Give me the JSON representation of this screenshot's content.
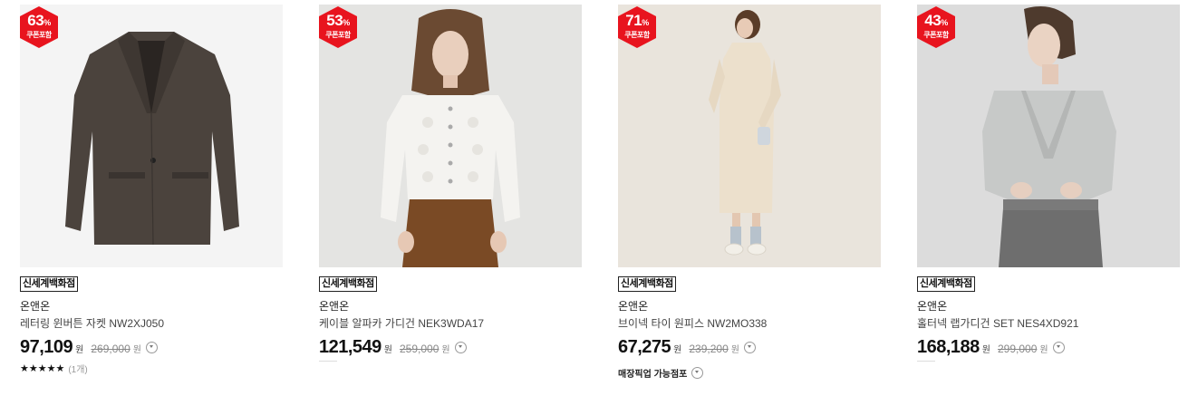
{
  "colors": {
    "badge_red": "#e8141e",
    "text": "#222222",
    "muted": "#888888"
  },
  "products": [
    {
      "discount": "63",
      "percent_sign": "%",
      "coupon_label": "쿠폰포함",
      "store": "신세계백화점",
      "brand": "온앤온",
      "name": "레터링 윈버튼 자켓 NW2XJ050",
      "price": "97,109",
      "price_unit": "원",
      "original_price": "269,000",
      "original_unit": "원",
      "stars": "★★★★★",
      "rating_count": "(1개)"
    },
    {
      "discount": "53",
      "percent_sign": "%",
      "coupon_label": "쿠폰포함",
      "store": "신세계백화점",
      "brand": "온앤온",
      "name": "케이블 알파카 가디건 NEK3WDA17",
      "price": "121,549",
      "price_unit": "원",
      "original_price": "259,000",
      "original_unit": "원"
    },
    {
      "discount": "71",
      "percent_sign": "%",
      "coupon_label": "쿠폰포함",
      "store": "신세계백화점",
      "brand": "온앤온",
      "name": "브이넥 타이 원피스 NW2MO338",
      "price": "67,275",
      "price_unit": "원",
      "original_price": "239,200",
      "original_unit": "원",
      "pickup_label": "매장픽업 가능점포"
    },
    {
      "discount": "43",
      "percent_sign": "%",
      "coupon_label": "쿠폰포함",
      "store": "신세계백화점",
      "brand": "온앤온",
      "name": "홀터넥 랩가디건 SET NES4XD921",
      "price": "168,188",
      "price_unit": "원",
      "original_price": "299,000",
      "original_unit": "원"
    }
  ]
}
